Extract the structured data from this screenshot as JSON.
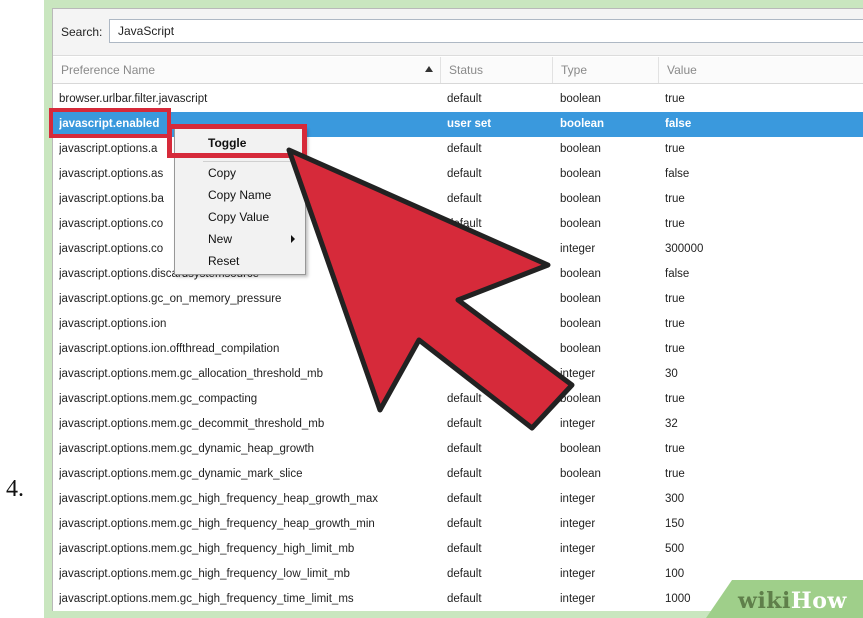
{
  "step_number": "4.",
  "search": {
    "label": "Search:",
    "value": "JavaScript"
  },
  "columns": {
    "name": "Preference Name",
    "status": "Status",
    "type": "Type",
    "value": "Value"
  },
  "rows": [
    {
      "name": "browser.urlbar.filter.javascript",
      "status": "default",
      "type": "boolean",
      "value": "true"
    },
    {
      "name": "javascript.enabled",
      "status": "user set",
      "type": "boolean",
      "value": "false",
      "selected": true
    },
    {
      "name": "javascript.options.a",
      "status": "default",
      "type": "boolean",
      "value": "true"
    },
    {
      "name": "javascript.options.as",
      "status": "default",
      "type": "boolean",
      "value": "false"
    },
    {
      "name": "javascript.options.ba",
      "status": "default",
      "type": "boolean",
      "value": "true"
    },
    {
      "name": "javascript.options.co",
      "status": "default",
      "type": "boolean",
      "value": "true"
    },
    {
      "name": "javascript.options.co",
      "status": "",
      "type": "integer",
      "value": "300000"
    },
    {
      "name": "javascript.options.discardsystemsource",
      "status": "",
      "type": "boolean",
      "value": "false"
    },
    {
      "name": "javascript.options.gc_on_memory_pressure",
      "status": "",
      "type": "boolean",
      "value": "true"
    },
    {
      "name": "javascript.options.ion",
      "status": "",
      "type": "boolean",
      "value": "true"
    },
    {
      "name": "javascript.options.ion.offthread_compilation",
      "status": "",
      "type": "boolean",
      "value": "true"
    },
    {
      "name": "javascript.options.mem.gc_allocation_threshold_mb",
      "status": "",
      "type": "integer",
      "value": "30"
    },
    {
      "name": "javascript.options.mem.gc_compacting",
      "status": "default",
      "type": "boolean",
      "value": "true"
    },
    {
      "name": "javascript.options.mem.gc_decommit_threshold_mb",
      "status": "default",
      "type": "integer",
      "value": "32"
    },
    {
      "name": "javascript.options.mem.gc_dynamic_heap_growth",
      "status": "default",
      "type": "boolean",
      "value": "true"
    },
    {
      "name": "javascript.options.mem.gc_dynamic_mark_slice",
      "status": "default",
      "type": "boolean",
      "value": "true"
    },
    {
      "name": "javascript.options.mem.gc_high_frequency_heap_growth_max",
      "status": "default",
      "type": "integer",
      "value": "300"
    },
    {
      "name": "javascript.options.mem.gc_high_frequency_heap_growth_min",
      "status": "default",
      "type": "integer",
      "value": "150"
    },
    {
      "name": "javascript.options.mem.gc_high_frequency_high_limit_mb",
      "status": "default",
      "type": "integer",
      "value": "500"
    },
    {
      "name": "javascript.options.mem.gc_high_frequency_low_limit_mb",
      "status": "default",
      "type": "integer",
      "value": "100"
    },
    {
      "name": "javascript.options.mem.gc_high_frequency_time_limit_ms",
      "status": "default",
      "type": "integer",
      "value": "1000"
    }
  ],
  "context_menu": {
    "toggle": "Toggle",
    "copy": "Copy",
    "copy_name": "Copy Name",
    "copy_value": "Copy Value",
    "new": "New",
    "reset": "Reset"
  },
  "watermark": {
    "wiki": "wiki",
    "how": "How"
  },
  "colors": {
    "highlight": "#d62a3a",
    "selection": "#3a99dd",
    "frame": "#c9e6bf"
  },
  "icons": {
    "sort": "sort-ascending-icon",
    "submenu": "submenu-arrow-icon",
    "pointer": "red-arrow-pointer-icon"
  }
}
